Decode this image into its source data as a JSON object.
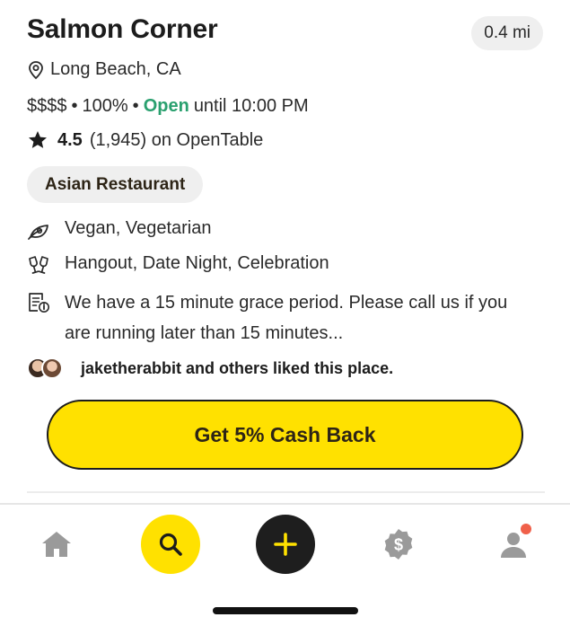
{
  "restaurant": {
    "name": "Salmon Corner",
    "distance": "0.4 mi",
    "location": "Long Beach, CA",
    "price": "$$$$",
    "match": "100%",
    "separator": "•",
    "status": "Open",
    "hours": "until 10:00 PM",
    "rating": "4.5",
    "reviews": "(1,945) on OpenTable",
    "category": "Asian Restaurant",
    "dietary": "Vegan, Vegetarian",
    "occasions": "Hangout, Date Night, Celebration",
    "policy": "We have a 15 minute grace period. Please call us if you are running later than 15 minutes...",
    "liked_by": "jaketherabbit and others liked this place."
  },
  "cta": {
    "label": "Get 5% Cash Back"
  },
  "colors": {
    "accent": "#ffe100",
    "open": "#2aa06f",
    "nav_icon": "#9a9a9a",
    "notification": "#f0604a"
  },
  "nav": {
    "items": [
      {
        "icon": "home-icon"
      },
      {
        "icon": "search-icon"
      },
      {
        "icon": "plus-icon"
      },
      {
        "icon": "cash-badge-icon"
      },
      {
        "icon": "profile-icon"
      }
    ]
  }
}
